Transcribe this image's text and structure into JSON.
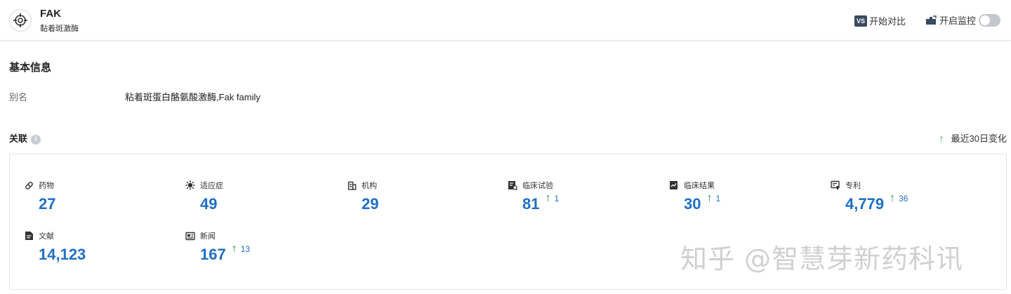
{
  "header": {
    "title": "FAK",
    "subtitle": "黏着斑激酶",
    "compare_label": "开始对比",
    "compare_icon_text": "VS",
    "monitor_label": "开启监控"
  },
  "basic_info": {
    "title": "基本信息",
    "alias_label": "别名",
    "alias_value": "粘着斑蛋白酪氨酸激酶,Fak family"
  },
  "relations": {
    "title": "关联",
    "info_icon": "i",
    "legend_arrow": "↑",
    "legend_label": "最近30日变化",
    "stats": [
      {
        "label": "药物",
        "value": "27",
        "delta": "",
        "icon": "pill-icon"
      },
      {
        "label": "适应症",
        "value": "49",
        "delta": "",
        "icon": "virus-icon"
      },
      {
        "label": "机构",
        "value": "29",
        "delta": "",
        "icon": "building-icon"
      },
      {
        "label": "临床试验",
        "value": "81",
        "delta": "1",
        "icon": "clinical-trial-icon"
      },
      {
        "label": "临床结果",
        "value": "30",
        "delta": "1",
        "icon": "clinical-result-icon"
      },
      {
        "label": "专利",
        "value": "4,779",
        "delta": "36",
        "icon": "patent-icon"
      },
      {
        "label": "文献",
        "value": "14,123",
        "delta": "",
        "icon": "document-icon"
      },
      {
        "label": "新闻",
        "value": "167",
        "delta": "13",
        "icon": "news-icon"
      }
    ]
  },
  "watermark": "知乎 @智慧芽新药科讯",
  "colors": {
    "accent": "#1f6fc5",
    "up": "#2e9a3f"
  }
}
